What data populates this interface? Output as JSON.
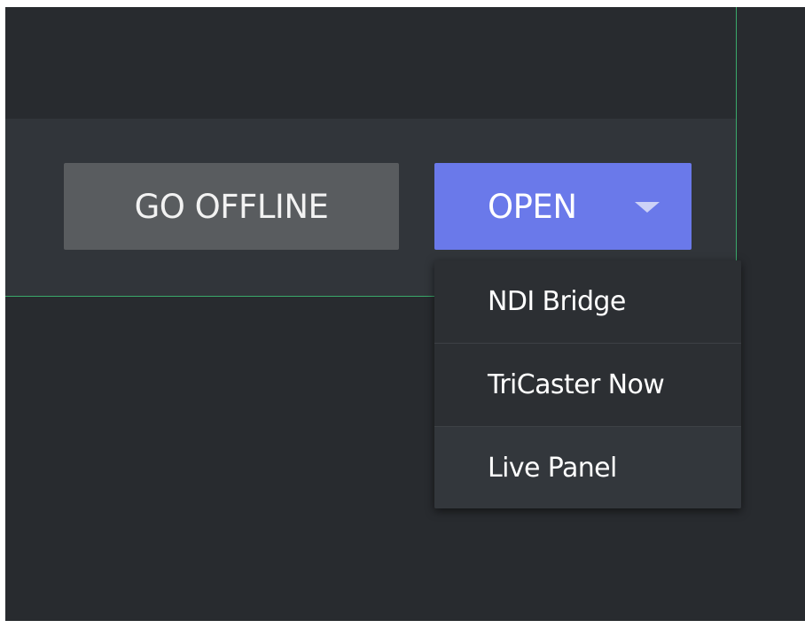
{
  "toolbar": {
    "go_offline_label": "GO OFFLINE",
    "open_label": "OPEN",
    "open_dropdown_icon": "caret-down-icon"
  },
  "open_menu": {
    "items": [
      {
        "label": "NDI Bridge"
      },
      {
        "label": "TriCaster Now"
      },
      {
        "label": "Live Panel"
      }
    ],
    "hovered_item": "Live Panel"
  },
  "colors": {
    "background": "#282b2f",
    "toolbar_bar": "#31353a",
    "offline_button": "#595c5f",
    "open_button": "#6a79ea",
    "divider_accent": "#3aa96b",
    "menu_background": "#2c2f33",
    "menu_hover": "#33373c",
    "text": "#ffffff"
  }
}
